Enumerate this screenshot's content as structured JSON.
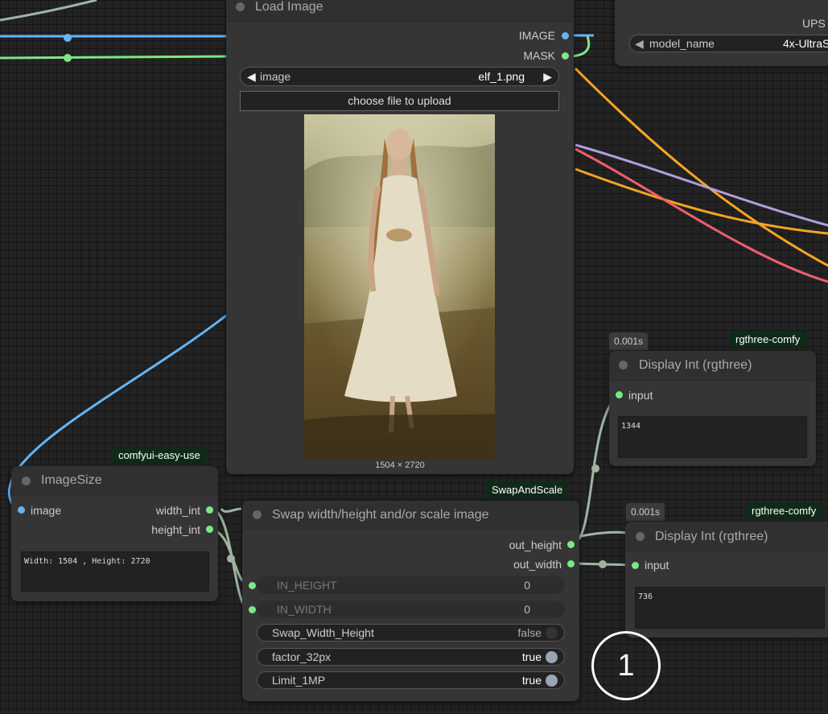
{
  "upscale_node": {
    "title_partial": "UPS",
    "widget_label": "model_name",
    "widget_value": "4x-UltraS"
  },
  "load_image": {
    "title": "Load Image",
    "outputs": [
      "IMAGE",
      "MASK"
    ],
    "image_widget": {
      "label": "image",
      "value": "elf_1.png"
    },
    "upload_button": "choose file to upload",
    "dimensions": "1504 × 2720"
  },
  "image_size": {
    "badge": "comfyui-easy-use",
    "title": "ImageSize",
    "input": "image",
    "outputs": [
      "width_int",
      "height_int"
    ],
    "text": "Width: 1504 , Height: 2720"
  },
  "swap": {
    "badge": "SwapAndScale",
    "title": "Swap width/height and/or scale image",
    "outputs": [
      "out_height",
      "out_width"
    ],
    "widgets": [
      {
        "label": "IN_HEIGHT",
        "value": "0"
      },
      {
        "label": "IN_WIDTH",
        "value": "0"
      },
      {
        "label": "Swap_Width_Height",
        "value": "false"
      },
      {
        "label": "factor_32px",
        "value": "true"
      },
      {
        "label": "Limit_1MP",
        "value": "true"
      }
    ]
  },
  "display_top": {
    "time": "0.001s",
    "badge": "rgthree-comfy",
    "title": "Display Int (rgthree)",
    "input": "input",
    "value": "1344"
  },
  "display_bottom": {
    "time": "0.001s",
    "badge": "rgthree-comfy",
    "title": "Display Int (rgthree)",
    "input": "input",
    "value": "736"
  },
  "overlay_label": "1",
  "colors": {
    "canvas": "#232323",
    "node": "#353535",
    "badge_bg": "#0f2a19",
    "wire_image": "#64b5f6",
    "wire_int": "#9fb5a2",
    "wire_green": "#7ee787",
    "wire_orange": "#f5a623",
    "wire_purple": "#b39ddb",
    "wire_red": "#ef5f6b"
  }
}
